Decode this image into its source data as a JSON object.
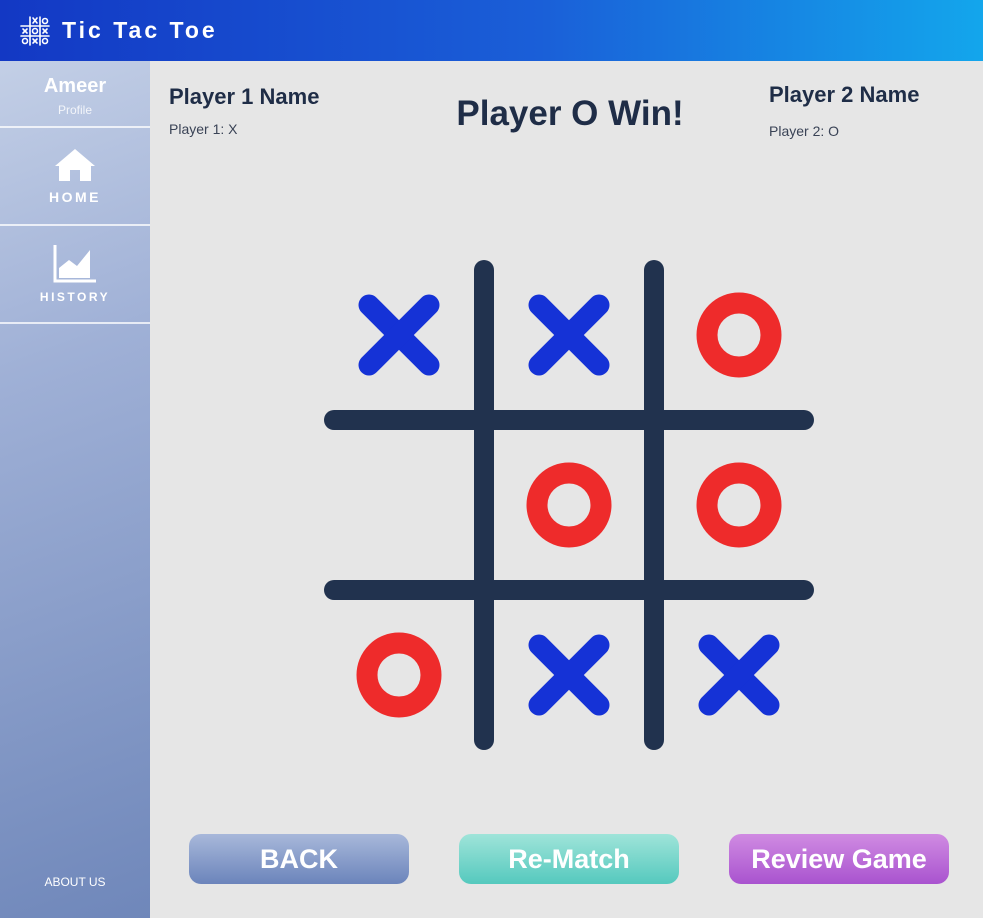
{
  "app": {
    "title": "Tic Tac Toe"
  },
  "sidebar": {
    "profile_name": "Ameer",
    "profile_label": "Profile",
    "items": [
      {
        "label": "HOME",
        "icon": "home-icon"
      },
      {
        "label": "HISTORY",
        "icon": "chart-icon"
      }
    ],
    "about_label": "ABOUT US"
  },
  "players": {
    "p1": {
      "title": "Player 1 Name",
      "symbol_label": "Player 1: X"
    },
    "p2": {
      "title": "Player 2 Name",
      "symbol_label": "Player 2: O"
    }
  },
  "status": "Player O Win!",
  "board": [
    "X",
    "X",
    "O",
    "",
    "O",
    "O",
    "O",
    "X",
    "X"
  ],
  "buttons": {
    "back": "BACK",
    "rematch": "Re-Match",
    "review": "Review Game"
  },
  "colors": {
    "x_mark": "#1532d6",
    "o_mark": "#ee2b2b",
    "grid_line": "#21324e",
    "header_start": "#1338c4",
    "header_end": "#13a6ec"
  }
}
